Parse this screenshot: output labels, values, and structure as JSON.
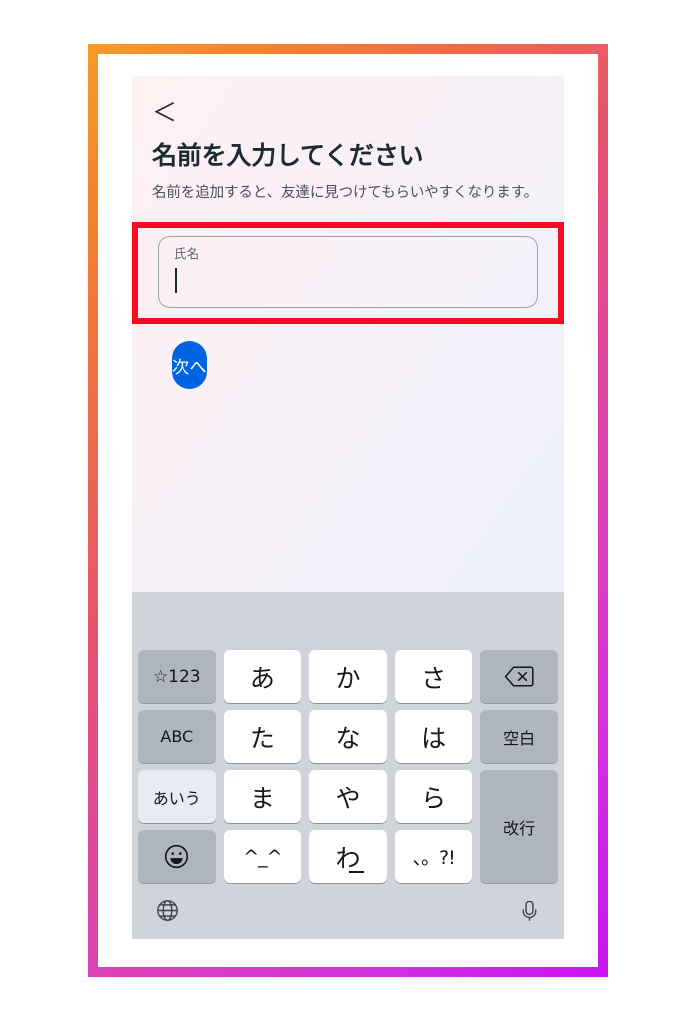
{
  "screen": {
    "back_icon": "chevron-left-icon",
    "title": "名前を入力してください",
    "subtitle": "名前を追加すると、友達に見つけてもらいやすくなります。"
  },
  "form": {
    "name_field": {
      "label": "氏名",
      "value": "",
      "placeholder": "氏名",
      "focused": true,
      "highlight_color": "#fa0a22"
    },
    "next_button": {
      "label": "次へ",
      "color": "#0064e0"
    }
  },
  "keyboard": {
    "layout": "japanese-kana-12key",
    "predictive_bar": "",
    "rows": [
      [
        {
          "label": "☆123",
          "name": "key-symbols-numbers",
          "type": "func"
        },
        {
          "label": "あ",
          "name": "key-a",
          "type": "char"
        },
        {
          "label": "か",
          "name": "key-ka",
          "type": "char"
        },
        {
          "label": "さ",
          "name": "key-sa",
          "type": "char"
        },
        {
          "label": "",
          "name": "key-backspace",
          "type": "icon",
          "icon": "delete-backspace-icon"
        }
      ],
      [
        {
          "label": "ABC",
          "name": "key-abc",
          "type": "func"
        },
        {
          "label": "た",
          "name": "key-ta",
          "type": "char"
        },
        {
          "label": "な",
          "name": "key-na",
          "type": "char"
        },
        {
          "label": "は",
          "name": "key-ha",
          "type": "char"
        },
        {
          "label": "空白",
          "name": "key-space",
          "type": "func"
        }
      ],
      [
        {
          "label": "あいう",
          "name": "key-aiu",
          "type": "func-active"
        },
        {
          "label": "ま",
          "name": "key-ma",
          "type": "char"
        },
        {
          "label": "や",
          "name": "key-ya",
          "type": "char"
        },
        {
          "label": "ら",
          "name": "key-ra",
          "type": "char"
        },
        {
          "label": "改行",
          "name": "key-return",
          "type": "func",
          "tall": true
        }
      ],
      [
        {
          "label": "",
          "name": "key-emoji",
          "type": "icon",
          "icon": "smiley-face-icon"
        },
        {
          "label": "^_^",
          "name": "key-kaomoji",
          "type": "char"
        },
        {
          "label": "わ",
          "name": "key-wa",
          "type": "char"
        },
        {
          "label": "、。?!",
          "name": "key-punctuation",
          "type": "char"
        }
      ]
    ],
    "bottom_bar": {
      "globe_icon": "globe-language-icon",
      "mic_icon": "microphone-icon"
    }
  }
}
